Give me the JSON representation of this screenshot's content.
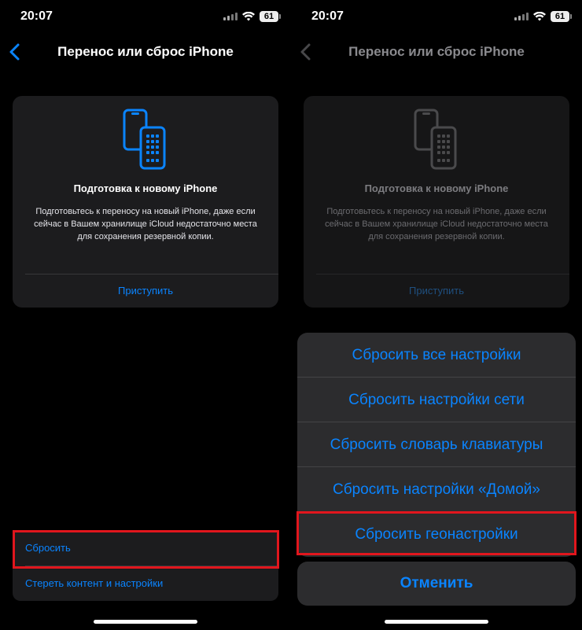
{
  "status_bar": {
    "time": "20:07",
    "battery": "61"
  },
  "nav": {
    "title": "Перенос или сброс iPhone"
  },
  "prepare_card": {
    "title": "Подготовка к новому iPhone",
    "description": "Подготовьтесь к переносу на новый iPhone, даже если сейчас в Вашем хранилище iCloud недостаточно места для сохранения резервной копии.",
    "action": "Приступить"
  },
  "reset_list": {
    "items": [
      {
        "label": "Сбросить"
      },
      {
        "label": "Стереть контент и настройки"
      }
    ]
  },
  "action_sheet": {
    "options": [
      {
        "label": "Сбросить все настройки"
      },
      {
        "label": "Сбросить настройки сети"
      },
      {
        "label": "Сбросить словарь клавиатуры"
      },
      {
        "label": "Сбросить настройки «Домой»"
      },
      {
        "label": "Сбросить геонастройки"
      }
    ],
    "cancel": "Отменить"
  },
  "colors": {
    "accent": "#0a84ff",
    "highlight": "#e1161d",
    "background": "#000000",
    "card": "#1c1c1e"
  },
  "icons": {
    "back": "chevron-left-icon",
    "signal": "cellular-signal-icon",
    "wifi": "wifi-icon",
    "battery": "battery-icon",
    "card": "iphone-transfer-icon"
  }
}
